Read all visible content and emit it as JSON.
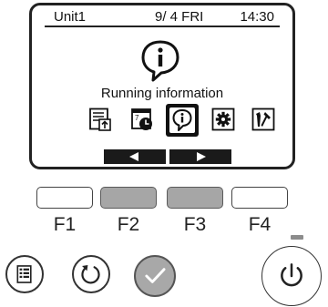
{
  "statusbar": {
    "unit": "Unit1",
    "date": "9/ 4 FRI",
    "time": "14:30"
  },
  "main": {
    "title": "Running information",
    "selected_icon": "info-icon",
    "icons": [
      "data-list-icon",
      "schedule-icon",
      "info-icon",
      "gear-icon",
      "maintenance-icon"
    ]
  },
  "nav": {
    "left": "left-arrow-icon",
    "right": "right-arrow-icon"
  },
  "function_keys": [
    {
      "label": "F1",
      "active": false
    },
    {
      "label": "F2",
      "active": true
    },
    {
      "label": "F3",
      "active": true
    },
    {
      "label": "F4",
      "active": false
    }
  ],
  "buttons": [
    "menu-icon",
    "return-icon",
    "check-icon",
    "power-icon"
  ],
  "colors": {
    "active_key": "#a6a6a6",
    "ok_button": "#a8a8a8",
    "led": "#8c8c8c"
  }
}
